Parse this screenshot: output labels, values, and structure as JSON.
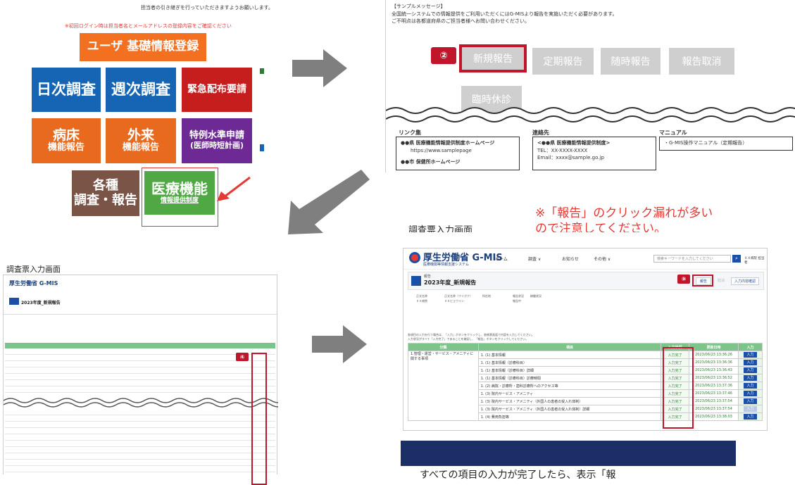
{
  "panel1": {
    "top_message": "担当者の引き継ぎを行っていただきますようお願いします。",
    "warning": "※初回ログイン時は担当者名とメールアドレスの登録内容をご確認ください",
    "tiles": {
      "user": "ユーザ 基礎情報登録",
      "daily": "日次調査",
      "weekly": "週次調査",
      "emergency": "緊急配布要請",
      "bed_main": "病床",
      "bed_sub": "機能報告",
      "out_main": "外来",
      "out_sub": "機能報告",
      "special_main": "特例水準申請",
      "special_sub": "(医師時短計画)",
      "various_1": "各種",
      "various_2": "調査・報告",
      "med_main": "医療機能",
      "med_sub": "情報提供制度"
    }
  },
  "panel2": {
    "msg_label": "【サンプルメッセージ】",
    "msg_line1": "全国統一システムでの情報提供をご利用いただくにはG-MISより報告を実施いただく必要があります。",
    "msg_line2": "ご不明点は各都道府県のご担当者様へお問い合わせください。",
    "step_badge": "②",
    "buttons": {
      "new": "新規報告",
      "periodic": "定期報告",
      "adhoc": "随時報告",
      "cancel": "報告取消",
      "closure": "臨時休診"
    },
    "footer": {
      "links_title": "リンク集",
      "link1": "●●県 医療機能情報提供制度ホームページ",
      "link1_url": "https://www.samplepage",
      "link2": "●●市 保健所ホームページ",
      "contact_title": "連絡先",
      "contact_name": "<●●県 医療機能情報提供制度>",
      "contact_tel": "TEL：XX-XXXX-XXXX",
      "contact_email": "Email：xxxx@sample.go.jp",
      "manual_title": "マニュアル",
      "manual_item": "・G-MIS操作マニュアル（定期報告）"
    }
  },
  "panel3": {
    "title": "調査票入力画面",
    "logo": "厚生労働省 G-MIS",
    "report_title": "2023年度_新規報告",
    "step_badge": "④"
  },
  "panel4": {
    "title": "調査票入力画面",
    "note_line1": "※「報告」のクリック漏れが多い",
    "note_line2": "ので注意してください。",
    "logo": "厚生労働省 G-MIS",
    "logo_sub": "医療機関等情報支援システム",
    "nav": [
      "ホーム",
      "調査 ∨",
      "お知らせ",
      "その他 ∨"
    ],
    "search_placeholder": "検索キーワードを入力してください",
    "user": "ＸＸ病院 担当者",
    "report_label": "報告",
    "report_title": "2023年度_新規報告",
    "step_badge": "⑨",
    "action_report": "報告",
    "action_undo": "取消",
    "action_confirm": "入力内容確認",
    "info_headers": [
      "正式名称",
      "正式名称（フリガナ）",
      "所在地",
      "報告状況",
      "稼働状況"
    ],
    "info_values": [
      "ＸＸ病院",
      "ＸＸビョウイン",
      "",
      "報告中",
      "-"
    ],
    "instructions1": "各項目の入力を行う場合は、「入力」ボタンをクリックし、各帳票画面で内容を入力してください。",
    "instructions2": "入力状況がすべて「入力完了」であることを確認し、「報告」ボタンをクリックしてください。",
    "table_headers": [
      "分類",
      "項目",
      "入力状況",
      "更新日時",
      "入力"
    ],
    "category": "1.管理・運営・サービス・アメニティに関する事項",
    "rows": [
      {
        "item": "1. (1) 基本情報",
        "status": "入力完了",
        "date": "2023/06/23 13:36:26",
        "btn": "入力"
      },
      {
        "item": "1. (1) 基本情報（診療科目）",
        "status": "入力完了",
        "date": "2023/06/23 13:36:36",
        "btn": "入力"
      },
      {
        "item": "1. (1) 基本情報（診療科目）詳細",
        "status": "入力完了",
        "date": "2023/06/23 13:36:43",
        "btn": "入力"
      },
      {
        "item": "1. (1) 基本情報（診療科目）診療時間",
        "status": "入力完了",
        "date": "2023/06/23 13:36:52",
        "btn": "入力"
      },
      {
        "item": "1. (2) 病院・診療所・歯科診療所へのアクセス等",
        "status": "入力完了",
        "date": "2023/06/23 13:37:36",
        "btn": "入力"
      },
      {
        "item": "1. (3) 院内サービス・アメニティ",
        "status": "入力完了",
        "date": "2023/06/23 13:37:46",
        "btn": "入力"
      },
      {
        "item": "1. (3) 院内サービス・アメニティ（外国人の患者の受入れ体制）",
        "status": "入力完了",
        "date": "2023/06/23 13:37:54",
        "btn": "入力"
      },
      {
        "item": "1. (3) 院内サービス・アメニティ（外国人の患者の受入れ体制）詳細",
        "status": "入力完了",
        "date": "2023/06/23 13:37:54",
        "btn": "入力"
      },
      {
        "item": "1. (4) 費用負担等",
        "status": "入力完了",
        "date": "2023/06/23 13:38:03",
        "btn": "入力"
      }
    ],
    "bottom_text": "すべての項目の入力が完了したら、表示「報"
  }
}
